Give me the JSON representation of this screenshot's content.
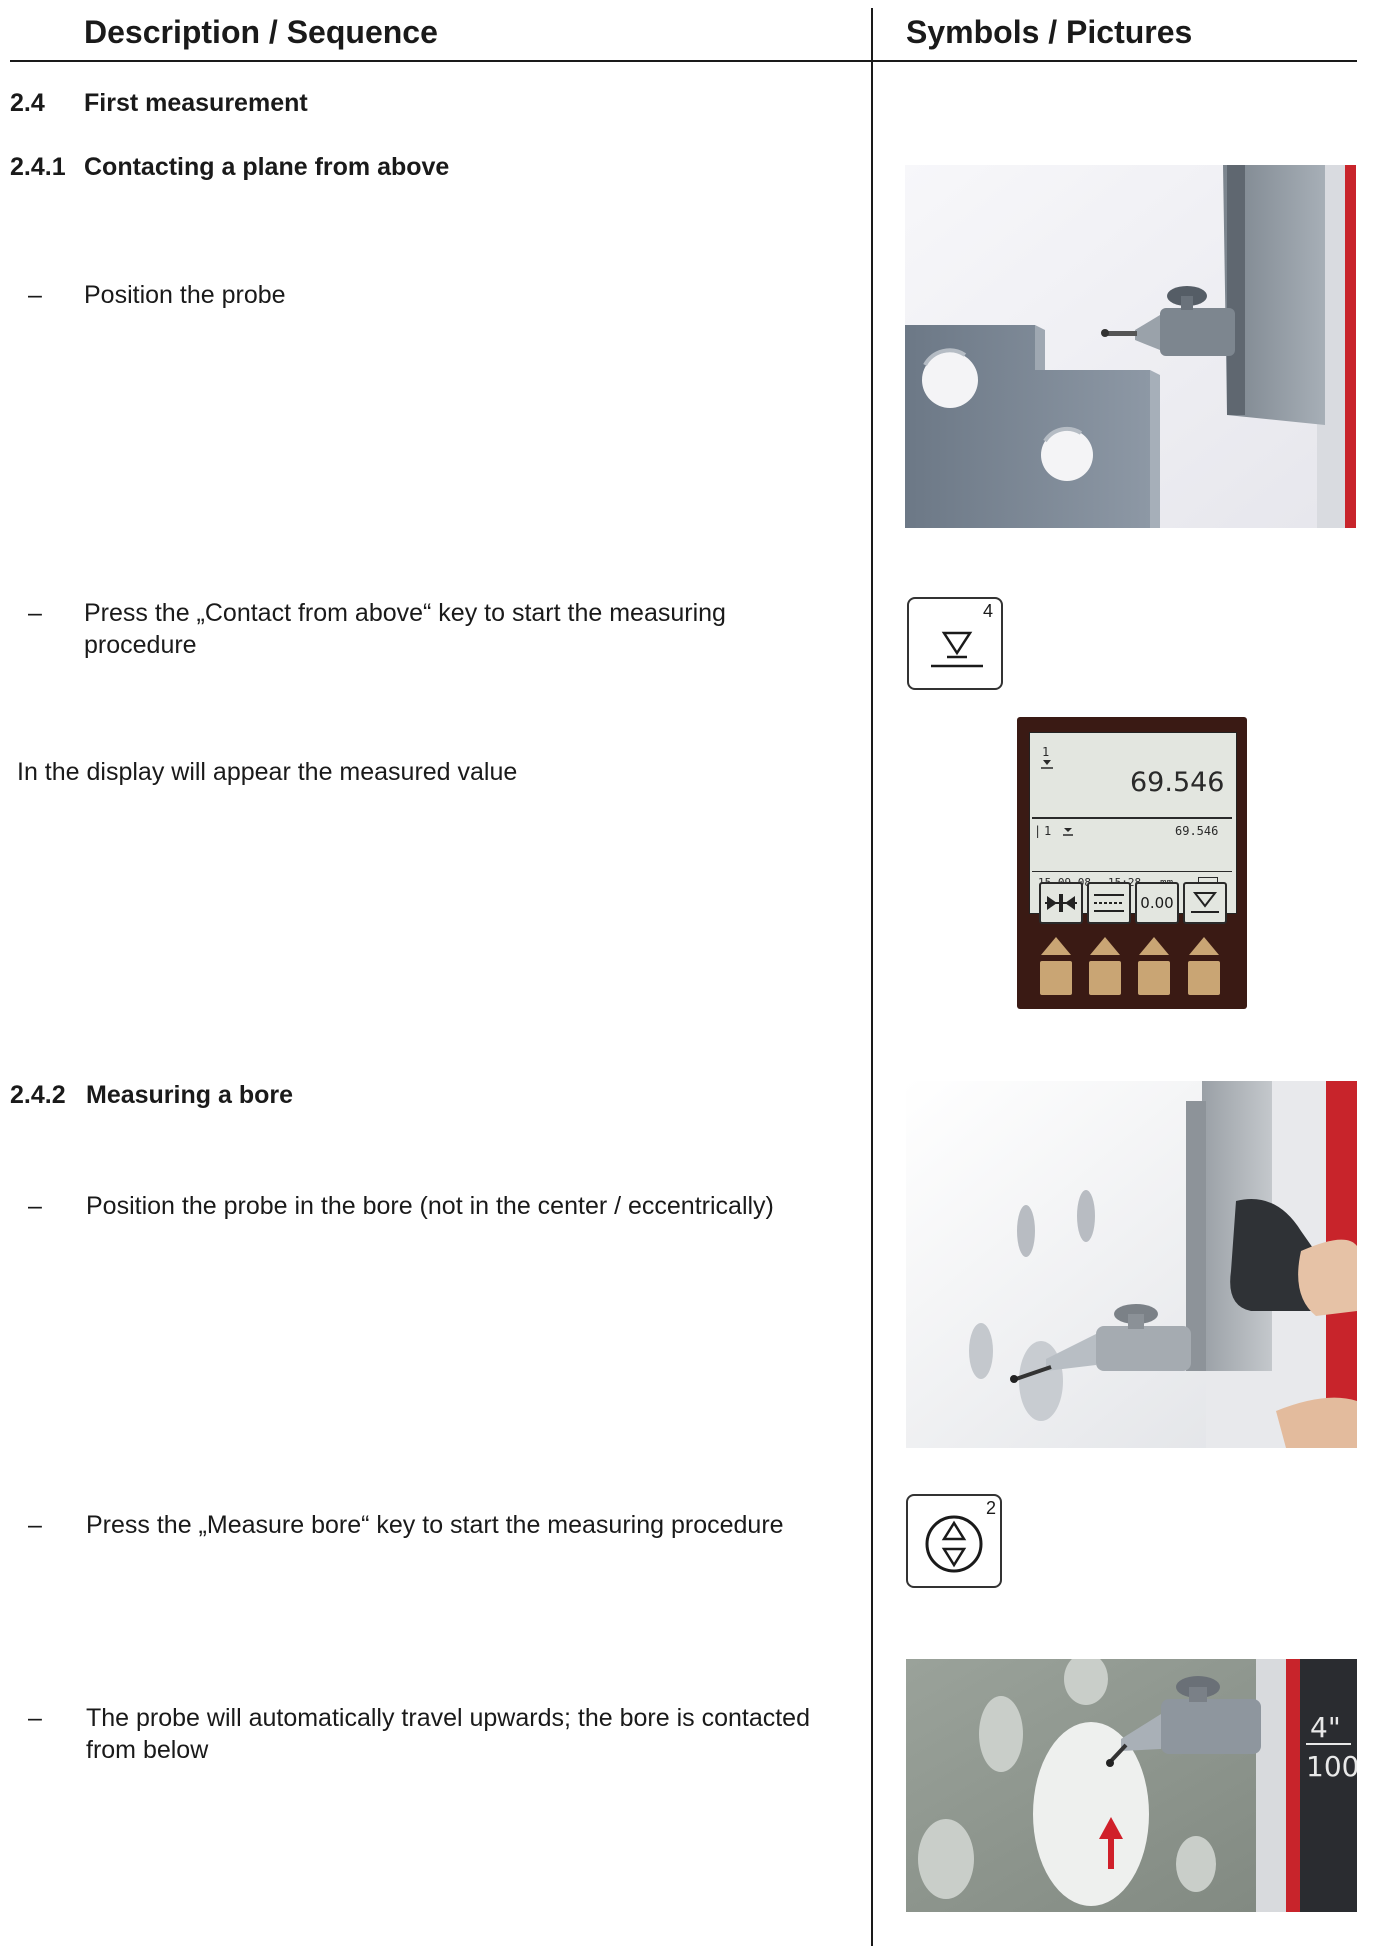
{
  "header": {
    "left_title": "Description / Sequence",
    "right_title": "Symbols / Pictures"
  },
  "section_2_4": {
    "number": "2.4",
    "title": "First measurement"
  },
  "section_2_4_1": {
    "number": "2.4.1",
    "title": "Contacting a plane from above"
  },
  "steps_2_4_1": [
    {
      "dash": "–",
      "text": "Position the probe"
    },
    {
      "dash": "–",
      "text_line1": "Press the „Contact from above“ key to start the measuring",
      "text_line2": "procedure"
    }
  ],
  "display_note": "In the display will appear the measured value",
  "key_contact_above": {
    "number": "4",
    "icon": "contact-from-above-icon"
  },
  "lcd": {
    "main_marker": "1",
    "main_value": "69.546",
    "list_index": "1",
    "list_value": "69.546",
    "date": "15.09.08",
    "time": "15:28",
    "unit": "mm",
    "softkey_3_label": "0.00"
  },
  "section_2_4_2": {
    "number": "2.4.2",
    "title": "Measuring a bore"
  },
  "steps_2_4_2": [
    {
      "dash": "–",
      "text": "Position the probe in the bore (not in the center / eccentrically)"
    },
    {
      "dash": "–",
      "text": "Press the „Measure bore“ key to start the measuring procedure"
    },
    {
      "dash": "–",
      "text_line1": "The probe will automatically travel upwards; the bore is contacted",
      "text_line2": "from below"
    }
  ],
  "key_measure_bore": {
    "number": "2",
    "icon": "measure-bore-icon"
  },
  "column_scale": {
    "top": "4\"",
    "bottom": "100"
  },
  "colors": {
    "text": "#1a1a1a",
    "lcd_background": "#e3e6e0",
    "device_frame": "#3a1a14",
    "column_red": "#c8242b",
    "softkey_tan": "#c9a574",
    "arrow_red": "#d0202a"
  }
}
